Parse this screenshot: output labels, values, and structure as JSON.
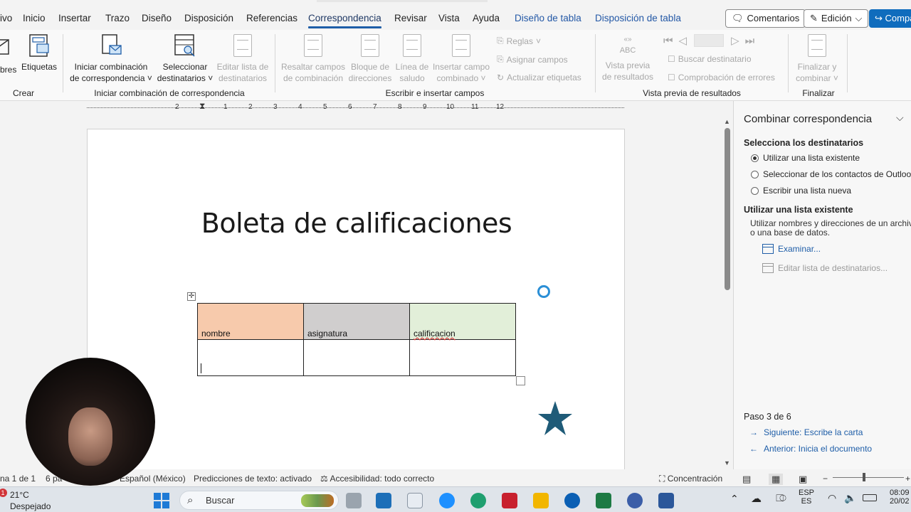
{
  "menu": {
    "tabs": [
      "ivo",
      "Inicio",
      "Insertar",
      "Trazo",
      "Diseño",
      "Disposición",
      "Referencias",
      "Correspondencia",
      "Revisar",
      "Vista",
      "Ayuda"
    ],
    "active_tab": "Correspondencia",
    "context_tabs": [
      "Diseño de tabla",
      "Disposición de tabla"
    ],
    "comments_label": "Comentarios",
    "edit_label": "Edición",
    "share_label": "Compa"
  },
  "ribbon": {
    "crear": {
      "sobres": "bres",
      "etiquetas": "Etiquetas",
      "group": "Crear"
    },
    "iniciar": {
      "iniciar_line1": "Iniciar combinación",
      "iniciar_line2": "de correspondencia",
      "seleccionar_line1": "Seleccionar",
      "seleccionar_line2": "destinatarios",
      "editar_line1": "Editar lista de",
      "editar_line2": "destinatarios",
      "group": "Iniciar combinación de correspondencia"
    },
    "escribir": {
      "resaltar_line1": "Resaltar campos",
      "resaltar_line2": "de combinación",
      "bloque_line1": "Bloque de",
      "bloque_line2": "direcciones",
      "linea_line1": "Línea de",
      "linea_line2": "saludo",
      "insertar_line1": "Insertar campo",
      "insertar_line2": "combinado",
      "reglas": "Reglas",
      "asignar": "Asignar campos",
      "actualizar": "Actualizar etiquetas",
      "group": "Escribir e insertar campos"
    },
    "vista": {
      "abc": "ABC",
      "vista_line1": "Vista previa",
      "vista_line2": "de resultados",
      "buscar": "Buscar destinatario",
      "comprobacion": "Comprobación de errores",
      "group": "Vista previa de resultados"
    },
    "finalizar": {
      "line1": "Finalizar y",
      "line2": "combinar",
      "group": "Finalizar"
    }
  },
  "ruler": {
    "numbers": [
      "2",
      "1",
      "1",
      "2",
      "3",
      "4",
      "5",
      "6",
      "7",
      "8",
      "9",
      "10",
      "11",
      "12"
    ]
  },
  "document": {
    "title": "Boleta de calificaciones",
    "table": {
      "headers": [
        "nombre",
        "asignatura",
        "calificacion"
      ],
      "header_colors": [
        "#f7caac",
        "#d0cece",
        "#e2efd9"
      ],
      "rows": [
        [
          "",
          "",
          ""
        ]
      ]
    },
    "star_color": "#1f5b78"
  },
  "pane": {
    "title": "Combinar correspondencia",
    "select_heading": "Selecciona los destinatarios",
    "options": [
      "Utilizar una lista existente",
      "Seleccionar de los contactos de Outlook",
      "Escribir una lista nueva"
    ],
    "selected_option": "Utilizar una lista existente",
    "use_heading": "Utilizar una lista existente",
    "use_desc": "Utilizar nombres y direcciones de un archivo o una base de datos.",
    "browse": "Examinar...",
    "edit_list": "Editar lista de destinatarios...",
    "step": "Paso 3 de 6",
    "next": "Siguiente: Escribe la carta",
    "prev": "Anterior: Inicia el documento"
  },
  "status": {
    "page": "na 1 de 1",
    "words": "6 pa",
    "language": "Español (México)",
    "predictions": "Predicciones de texto: activado",
    "accessibility": "Accesibilidad: todo correcto",
    "focus": "Concentración"
  },
  "taskbar": {
    "weather_temp": "21°C",
    "weather_desc": "Despejado",
    "weather_badge": "1",
    "search_placeholder": "Buscar",
    "lang_top": "ESP",
    "lang_bottom": "ES",
    "time": "08:09",
    "date": "20/02"
  }
}
